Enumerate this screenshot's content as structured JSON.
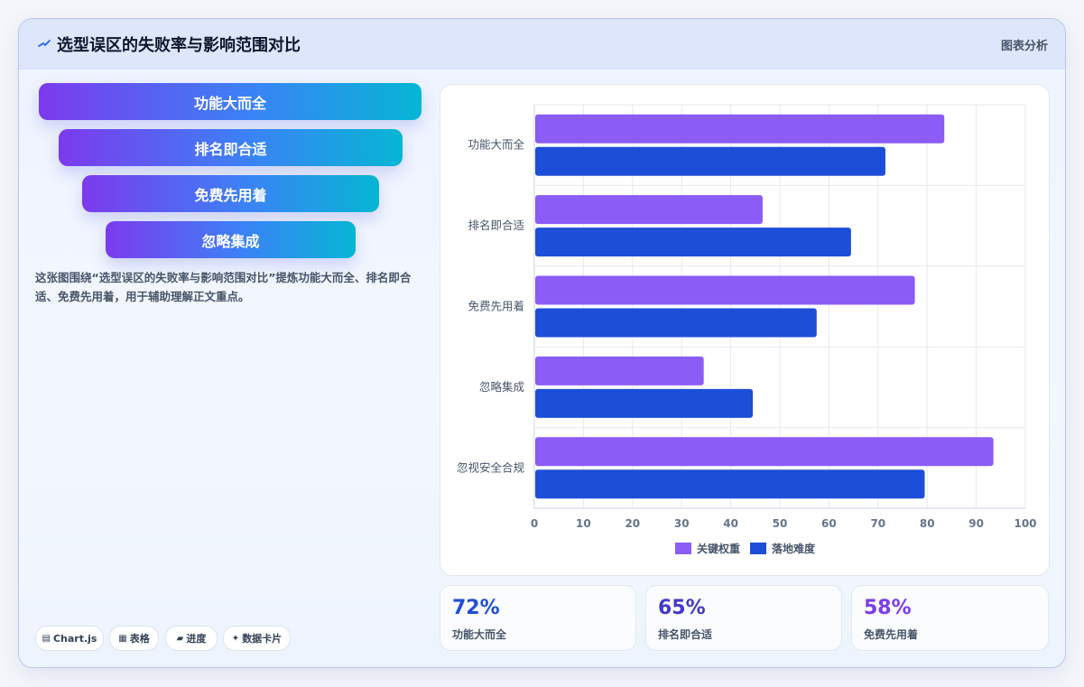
{
  "header": {
    "title": "选型误区的失败率与影响范围对比",
    "tag": "图表分析"
  },
  "funnel": [
    "功能大而全",
    "排名即合适",
    "免费先用着",
    "忽略集成"
  ],
  "description": "这张图围绕“选型误区的失败率与影响范围对比”提炼功能大而全、排名即合适、免费先用着，用于辅助理解正文重点。",
  "pills": [
    {
      "icon": "▤",
      "icon_name": "chart-icon",
      "label": "Chart.js"
    },
    {
      "icon": "▦",
      "icon_name": "table-icon",
      "label": "表格"
    },
    {
      "icon": "▰",
      "icon_name": "progress-icon",
      "label": "进度"
    },
    {
      "icon": "✦",
      "icon_name": "sparkle-icon",
      "label": "数据卡片"
    }
  ],
  "stats": [
    {
      "value": "72%",
      "label": "功能大而全",
      "color": "#1d4ed8"
    },
    {
      "value": "65%",
      "label": "排名即合适",
      "color": "#4338ca"
    },
    {
      "value": "58%",
      "label": "免费先用着",
      "color": "#7c3aed"
    }
  ],
  "chart_data": {
    "type": "bar",
    "orientation": "horizontal",
    "categories": [
      "功能大而全",
      "排名即合适",
      "免费先用着",
      "忽略集成",
      "忽视安全合规"
    ],
    "series": [
      {
        "name": "关键权重",
        "values": [
          83.5,
          46.5,
          77.5,
          34.5,
          93.5
        ],
        "color": "#8b5cf6"
      },
      {
        "name": "落地难度",
        "values": [
          71.5,
          64.5,
          57.5,
          44.5,
          79.5
        ],
        "color": "#1d4ed8"
      }
    ],
    "xlim": [
      0,
      100
    ],
    "xticks": [
      0,
      10,
      20,
      30,
      40,
      50,
      60,
      70,
      80,
      90,
      100
    ],
    "grid": true,
    "legend_position": "bottom"
  }
}
